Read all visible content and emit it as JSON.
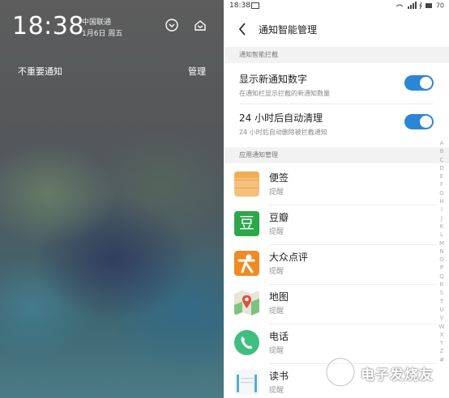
{
  "left_panel": {
    "time": "18:38",
    "carrier": "中国联通",
    "date": "1月6日 周五",
    "unimportant_label": "不重要通知",
    "manage_label": "管理"
  },
  "status_bar": {
    "time": "18:38",
    "battery": "70"
  },
  "header": {
    "title": "通知智能管理"
  },
  "section_interception": {
    "label": "通知智能拦截"
  },
  "settings": [
    {
      "title": "显示新通知数字",
      "subtitle": "在通知栏显示拦截的新通知数量",
      "enabled": true
    },
    {
      "title": "24 小时后自动清理",
      "subtitle": "24 小时后自动删除被拦截通知",
      "enabled": true
    }
  ],
  "section_apps": {
    "label": "应用通知管理"
  },
  "apps": [
    {
      "name": "便签",
      "status": "提醒",
      "icon": "notes-icon"
    },
    {
      "name": "豆瓣",
      "status": "提醒",
      "icon": "douban-icon",
      "icon_char": "豆"
    },
    {
      "name": "大众点评",
      "status": "提醒",
      "icon": "dianping-icon"
    },
    {
      "name": "地图",
      "status": "提醒",
      "icon": "map-icon"
    },
    {
      "name": "电话",
      "status": "提醒",
      "icon": "phone-icon"
    },
    {
      "name": "读书",
      "status": "提醒",
      "icon": "books-icon"
    }
  ],
  "alphabet_index": [
    "A",
    "B",
    "C",
    "D",
    "E",
    "F",
    "G",
    "H",
    "I",
    "J",
    "K",
    "L",
    "M",
    "N",
    "O",
    "P",
    "Q",
    "R",
    "S",
    "T",
    "U",
    "V",
    "W",
    "X",
    "Y",
    "Z",
    "#"
  ],
  "watermark": {
    "text": "电子发烧友"
  },
  "colors": {
    "accent": "#2b86d4",
    "douban": "#2aa84a",
    "dianping": "#f08a24",
    "phone": "#3dbf7f"
  }
}
